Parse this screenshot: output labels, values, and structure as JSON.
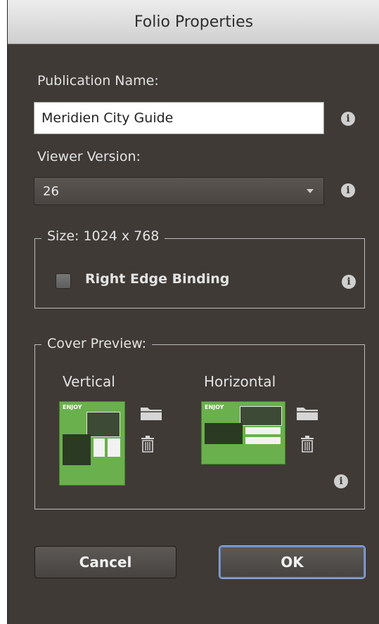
{
  "window": {
    "title": "Folio Properties"
  },
  "publication": {
    "label": "Publication Name:",
    "value": "Meridien City Guide"
  },
  "viewer": {
    "label": "Viewer Version:",
    "selected": "26"
  },
  "size": {
    "legend": "Size: 1024 x 768",
    "right_edge_binding_label": "Right Edge Binding",
    "right_edge_binding_checked": false
  },
  "cover": {
    "legend": "Cover Preview:",
    "vertical_label": "Vertical",
    "horizontal_label": "Horizontal",
    "thumb_logo": "ENJOY"
  },
  "buttons": {
    "cancel": "Cancel",
    "ok": "OK"
  },
  "icons": {
    "info": "info-icon",
    "folder": "folder-icon",
    "trash": "trash-icon",
    "dropdown": "chevron-down-icon"
  },
  "colors": {
    "panel": "#3f3a36",
    "thumbnail_green": "#6ab04c",
    "ok_focus": "#6d8cc7"
  }
}
